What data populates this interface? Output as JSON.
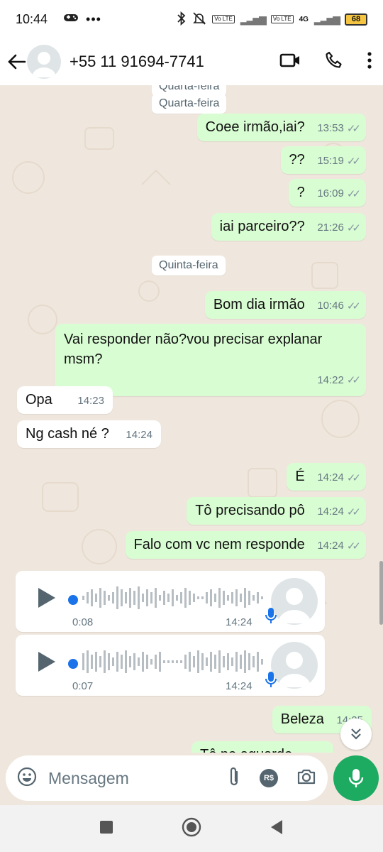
{
  "status_bar": {
    "time": "10:44",
    "network": "4G",
    "battery": "68",
    "volte1": "Vo LTE",
    "volte2": "Vo LTE"
  },
  "header": {
    "contact": "+55 11 91694-7741"
  },
  "days": {
    "wed_top": "Quarta-feira",
    "wed": "Quarta-feira",
    "thu": "Quinta-feira"
  },
  "messages": [
    {
      "text": "Coee irmão,iai?",
      "time": "13:53"
    },
    {
      "text": "??",
      "time": "15:19"
    },
    {
      "text": "?",
      "time": "16:09"
    },
    {
      "text": "iai parceiro??",
      "time": "21:26"
    },
    {
      "text": "Bom dia irmão",
      "time": "10:46"
    },
    {
      "text": "Vai responder não?vou precisar explanar msm?",
      "time": "14:22"
    },
    {
      "text": "Opa",
      "time": "14:23"
    },
    {
      "text": "Ng cash né ?",
      "time": "14:24"
    },
    {
      "text": "É",
      "time": "14:24"
    },
    {
      "text": "Tô precisando pô",
      "time": "14:24"
    },
    {
      "text": "Falo com vc nem responde",
      "time": "14:24"
    },
    {
      "text": "Beleza",
      "time": "14:25"
    },
    {
      "text": "Tô no aguardo",
      "time": ""
    }
  ],
  "voice_notes": [
    {
      "duration": "0:08",
      "time": "14:24"
    },
    {
      "duration": "0:07",
      "time": "14:24"
    }
  ],
  "input": {
    "placeholder": "Mensagem",
    "currency": "R$"
  },
  "colors": {
    "outgoing": "#d9fdd3",
    "incoming": "#ffffff",
    "accent": "#1daa61",
    "voice_dot": "#1a73e8"
  }
}
